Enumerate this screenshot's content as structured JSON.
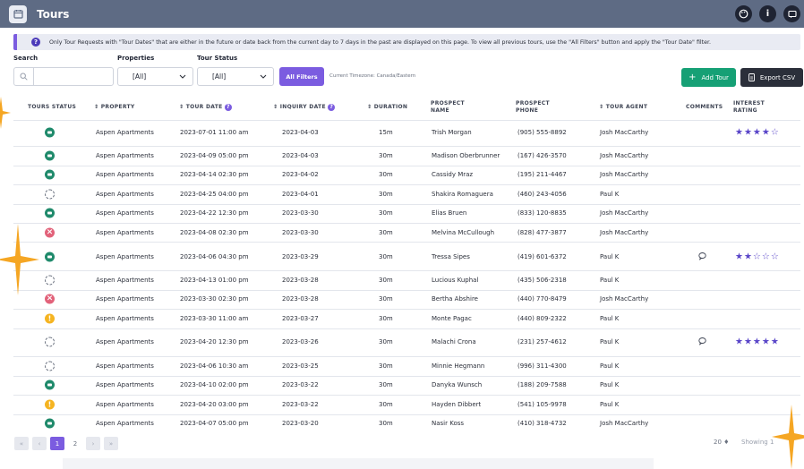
{
  "app": {
    "title": "Tours"
  },
  "notice": {
    "text": "Only Tour Requests with \"Tour Dates\" that are either in the future or date back from the current day to 7 days in the past are displayed on this page. To view all previous tours, use the \"All Filters\" button and apply the \"Tour Date\" filter."
  },
  "filters": {
    "search_label": "Search",
    "search_value": "",
    "properties_label": "Properties",
    "properties_value": "[All]",
    "status_label": "Tour Status",
    "status_value": "[All]",
    "all_filters_label": "All Filters",
    "timezone": "Current Timezone: Canada/Eastern"
  },
  "actions": {
    "add_tour": "Add Tour",
    "export_csv": "Export CSV"
  },
  "table": {
    "headers": {
      "status": "TOURS STATUS",
      "property": "PROPERTY",
      "tour_date": "TOUR DATE",
      "inquiry_date": "INQUIRY DATE",
      "duration": "DURATION",
      "prospect_name_1": "PROSPECT",
      "prospect_name_2": "NAME",
      "prospect_phone_1": "PROSPECT",
      "prospect_phone_2": "PHONE",
      "tour_agent": "TOUR AGENT",
      "comments": "COMMENTS",
      "interest_1": "INTEREST",
      "interest_2": "RATING"
    },
    "rows": [
      {
        "status": "green",
        "property": "Aspen Apartments",
        "tour_date": "2023-07-01 11:00 am",
        "inquiry_date": "2023-04-03",
        "duration": "15m",
        "name": "Trish Morgan",
        "phone": "(905) 555-8892",
        "agent": "Josh MacCarthy",
        "comment": false,
        "stars": "★★★★☆"
      },
      {
        "status": "green",
        "property": "Aspen Apartments",
        "tour_date": "2023-04-09 05:00 pm",
        "inquiry_date": "2023-04-03",
        "duration": "30m",
        "name": "Madison Oberbrunner",
        "phone": "(167) 426-3570",
        "agent": "Josh MacCarthy",
        "comment": false,
        "stars": ""
      },
      {
        "status": "green",
        "property": "Aspen Apartments",
        "tour_date": "2023-04-14 02:30 pm",
        "inquiry_date": "2023-04-02",
        "duration": "30m",
        "name": "Cassidy Mraz",
        "phone": "(195) 211-4467",
        "agent": "Josh MacCarthy",
        "comment": false,
        "stars": ""
      },
      {
        "status": "pending",
        "property": "Aspen Apartments",
        "tour_date": "2023-04-25 04:00 pm",
        "inquiry_date": "2023-04-01",
        "duration": "30m",
        "name": "Shakira Romaguera",
        "phone": "(460) 243-4056",
        "agent": "Paul K",
        "comment": false,
        "stars": ""
      },
      {
        "status": "green",
        "property": "Aspen Apartments",
        "tour_date": "2023-04-22 12:30 pm",
        "inquiry_date": "2023-03-30",
        "duration": "30m",
        "name": "Elias Bruen",
        "phone": "(833) 120-8835",
        "agent": "Josh MacCarthy",
        "comment": false,
        "stars": ""
      },
      {
        "status": "red",
        "property": "Aspen Apartments",
        "tour_date": "2023-04-08 02:30 pm",
        "inquiry_date": "2023-03-30",
        "duration": "30m",
        "name": "Melvina McCullough",
        "phone": "(828) 477-3877",
        "agent": "Josh MacCarthy",
        "comment": false,
        "stars": ""
      },
      {
        "status": "green",
        "property": "Aspen Apartments",
        "tour_date": "2023-04-06 04:30 pm",
        "inquiry_date": "2023-03-29",
        "duration": "30m",
        "name": "Tressa Sipes",
        "phone": "(419) 601-6372",
        "agent": "Paul K",
        "comment": true,
        "stars": "★★☆☆☆"
      },
      {
        "status": "pending",
        "property": "Aspen Apartments",
        "tour_date": "2023-04-13 01:00 pm",
        "inquiry_date": "2023-03-28",
        "duration": "30m",
        "name": "Lucious Kuphal",
        "phone": "(435) 506-2318",
        "agent": "Paul K",
        "comment": false,
        "stars": ""
      },
      {
        "status": "red",
        "property": "Aspen Apartments",
        "tour_date": "2023-03-30 02:30 pm",
        "inquiry_date": "2023-03-28",
        "duration": "30m",
        "name": "Bertha Abshire",
        "phone": "(440) 770-8479",
        "agent": "Josh MacCarthy",
        "comment": false,
        "stars": ""
      },
      {
        "status": "yellow",
        "property": "Aspen Apartments",
        "tour_date": "2023-03-30 11:00 am",
        "inquiry_date": "2023-03-27",
        "duration": "30m",
        "name": "Monte Pagac",
        "phone": "(440) 809-2322",
        "agent": "Paul K",
        "comment": false,
        "stars": ""
      },
      {
        "status": "pending",
        "property": "Aspen Apartments",
        "tour_date": "2023-04-20 12:30 pm",
        "inquiry_date": "2023-03-26",
        "duration": "30m",
        "name": "Malachi Crona",
        "phone": "(231) 257-4612",
        "agent": "Paul K",
        "comment": true,
        "stars": "★★★★★"
      },
      {
        "status": "pending",
        "property": "Aspen Apartments",
        "tour_date": "2023-04-06 10:30 am",
        "inquiry_date": "2023-03-25",
        "duration": "30m",
        "name": "Minnie Hegmann",
        "phone": "(996) 311-4300",
        "agent": "Paul K",
        "comment": false,
        "stars": ""
      },
      {
        "status": "green",
        "property": "Aspen Apartments",
        "tour_date": "2023-04-10 02:00 pm",
        "inquiry_date": "2023-03-22",
        "duration": "30m",
        "name": "Danyka Wunsch",
        "phone": "(188) 209-7588",
        "agent": "Paul K",
        "comment": false,
        "stars": ""
      },
      {
        "status": "yellow",
        "property": "Aspen Apartments",
        "tour_date": "2023-04-20 03:00 pm",
        "inquiry_date": "2023-03-22",
        "duration": "30m",
        "name": "Hayden Dibbert",
        "phone": "(541) 105-9978",
        "agent": "Paul K",
        "comment": false,
        "stars": ""
      },
      {
        "status": "green",
        "property": "Aspen Apartments",
        "tour_date": "2023-04-07 05:00 pm",
        "inquiry_date": "2023-03-20",
        "duration": "30m",
        "name": "Nasir Koss",
        "phone": "(410) 318-4732",
        "agent": "Josh MacCarthy",
        "comment": false,
        "stars": ""
      }
    ]
  },
  "pagination": {
    "first": "«",
    "prev": "‹",
    "pages": [
      "1",
      "2"
    ],
    "next": "›",
    "last": "»",
    "page_size": "20 ♦",
    "showing": "Showing 1"
  },
  "colors": {
    "accent": "#7b5ce0",
    "topbar": "#5e6b84",
    "success": "#16a075"
  }
}
